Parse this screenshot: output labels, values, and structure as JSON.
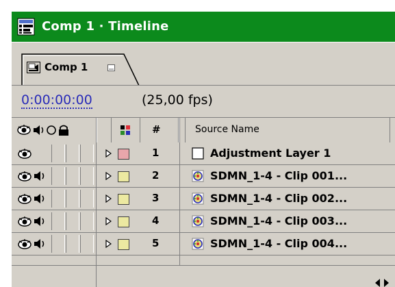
{
  "window": {
    "title": "Comp 1 · Timeline",
    "title_bar_color": "#0c8a1c"
  },
  "tab": {
    "label": "Comp 1"
  },
  "time": {
    "timecode": "0:00:00:00",
    "fps": "(25,00 fps)",
    "timecode_color": "#2a2cb8"
  },
  "columns": {
    "number": "#",
    "source_name": "Source Name"
  },
  "layers": [
    {
      "number": "1",
      "name": "Adjustment Layer 1",
      "label_color": "#e8a6ab",
      "audio": false,
      "icon": "solid-layer-icon"
    },
    {
      "number": "2",
      "name": "SDMN_1-4 - Clip 001...",
      "label_color": "#ece9a1",
      "audio": true,
      "icon": "footage-icon"
    },
    {
      "number": "3",
      "name": "SDMN_1-4 - Clip 002...",
      "label_color": "#ece9a1",
      "audio": true,
      "icon": "footage-icon"
    },
    {
      "number": "4",
      "name": "SDMN_1-4 - Clip 003...",
      "label_color": "#ece9a1",
      "audio": true,
      "icon": "footage-icon"
    },
    {
      "number": "5",
      "name": "SDMN_1-4 - Clip 004...",
      "label_color": "#ece9a1",
      "audio": true,
      "icon": "footage-icon"
    }
  ]
}
